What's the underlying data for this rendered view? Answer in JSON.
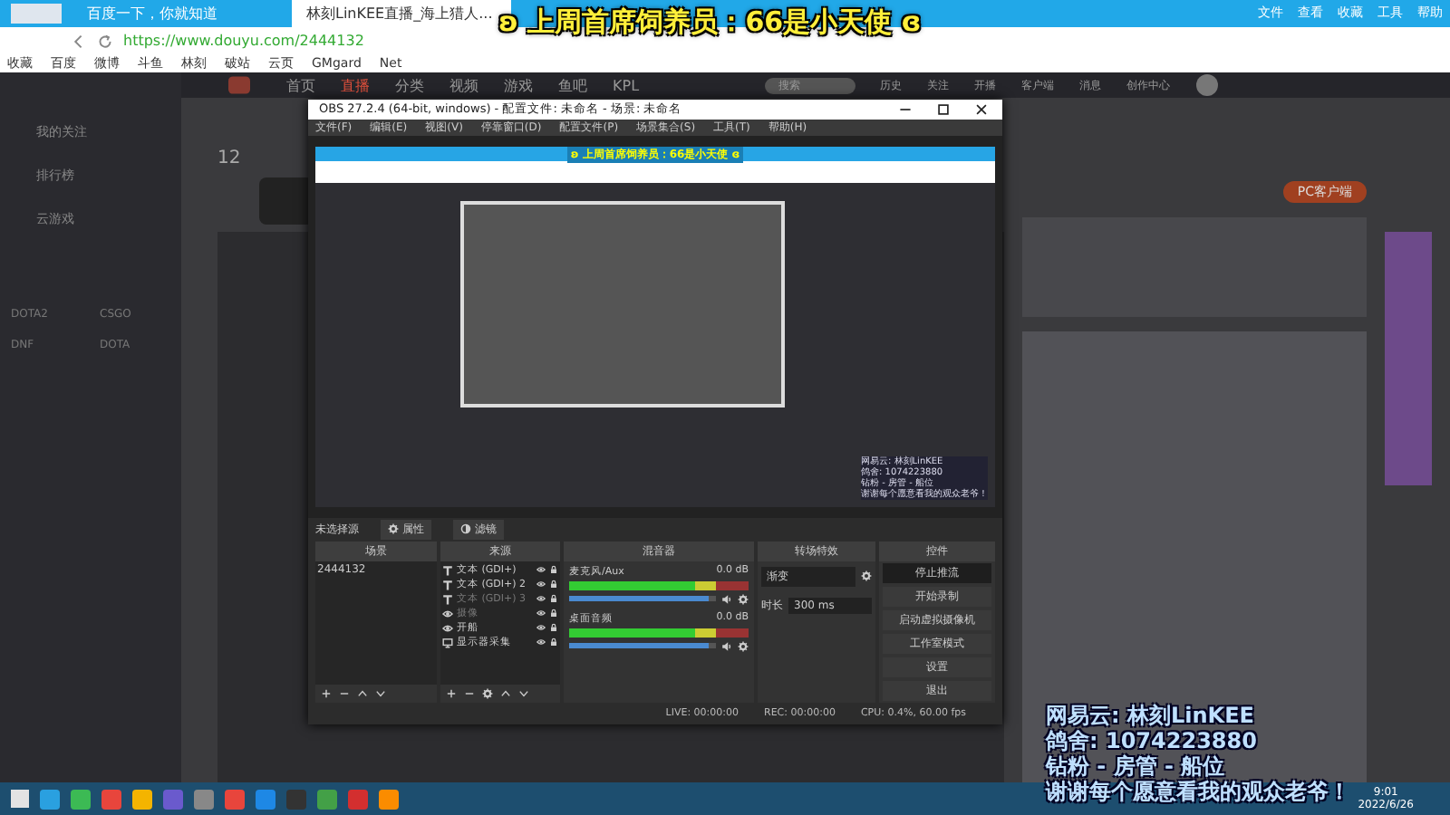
{
  "browser": {
    "tabs": [
      {
        "label": "百度一下，你就知道",
        "selected": false
      },
      {
        "label": "林刻LinKEE直播_海上猎人...",
        "selected": true
      }
    ],
    "menu": [
      "文件",
      "查看",
      "收藏",
      "工具",
      "帮助"
    ],
    "url": "https://www.douyu.com/2444132",
    "bookmarks": [
      "收藏",
      "百度",
      "微博",
      "斗鱼",
      "林刻",
      "破站",
      "云页",
      "GMgard",
      "Net"
    ]
  },
  "overlay": {
    "headline": "ʚ 上周首席饲养员：66是小天使 ɞ",
    "lines": [
      "网易云: 林刻LinKEE",
      "鸽舍: 1074223880",
      "钻粉 - 房管 - 船位",
      "谢谢每个愿意看我的观众老爷！"
    ]
  },
  "site": {
    "nav": [
      {
        "label": "首页",
        "selected": false
      },
      {
        "label": "直播",
        "selected": true
      },
      {
        "label": "分类",
        "selected": false
      },
      {
        "label": "视频",
        "selected": false
      },
      {
        "label": "游戏",
        "selected": false
      },
      {
        "label": "鱼吧",
        "selected": false
      },
      {
        "label": "KPL",
        "selected": false
      }
    ],
    "search_placeholder": "搜索",
    "toolbar": [
      "历史",
      "关注",
      "开播",
      "客户端",
      "消息",
      "创作中心"
    ],
    "sidebar": [
      "我的关注",
      "排行榜",
      "云游戏"
    ],
    "categories": [
      "DOTA2",
      "CSGO",
      "DNF",
      "DOTA"
    ],
    "count": "12",
    "client_button": "PC客户端"
  },
  "obs": {
    "title": "OBS 27.2.4 (64-bit, windows) - 配置文件: 未命名 - 场景: 未命名",
    "menu": [
      "文件(F)",
      "编辑(E)",
      "视图(V)",
      "停靠窗口(D)",
      "配置文件(P)",
      "场景集合(S)",
      "工具(T)",
      "帮助(H)"
    ],
    "preview": {
      "headline": "ʚ 上周首席饲养员：66是小天使 ɞ",
      "lines": [
        "网易云: 林刻LinKEE",
        "鸽舍: 1074223880",
        "钻粉 - 房管 - 船位",
        "谢谢每个愿意看我的观众老爷！"
      ]
    },
    "source_label": "未选择源",
    "properties": "属性",
    "filters": "滤镜",
    "docks": [
      "场景",
      "来源",
      "混音器",
      "转场特效",
      "控件"
    ],
    "scenes": [
      {
        "name": "2444132",
        "selected": false
      }
    ],
    "sources": [
      {
        "name": "文本 (GDI+)",
        "kind": "text",
        "visible": true
      },
      {
        "name": "文本 (GDI+) 2",
        "kind": "text",
        "visible": true
      },
      {
        "name": "文本 (GDI+) 3",
        "kind": "text",
        "visible": false
      },
      {
        "name": "摄像",
        "kind": "camera",
        "visible": false
      },
      {
        "name": "开船",
        "kind": "camera",
        "visible": true
      },
      {
        "name": "显示器采集",
        "kind": "monitor",
        "visible": true
      }
    ],
    "mixer": [
      {
        "name": "麦克风/Aux",
        "reading": "0.0 dB",
        "level": 0.95
      },
      {
        "name": "桌面音频",
        "reading": "0.0 dB",
        "level": 0.95
      }
    ],
    "transition": {
      "value": "渐变",
      "duration_label": "时长",
      "duration": "300 ms"
    },
    "controls": [
      {
        "label": "停止推流",
        "selected": true
      },
      {
        "label": "开始录制",
        "selected": false
      },
      {
        "label": "启动虚拟摄像机",
        "selected": false
      },
      {
        "label": "工作室模式",
        "selected": false
      },
      {
        "label": "设置",
        "selected": false
      },
      {
        "label": "退出",
        "selected": false
      }
    ],
    "status": [
      "LIVE: 00:00:00",
      "REC: 00:00:00",
      "CPU: 0.4%, 60.00 fps"
    ]
  },
  "taskbar": {
    "time": "9:01",
    "date": "2022/6/26"
  }
}
